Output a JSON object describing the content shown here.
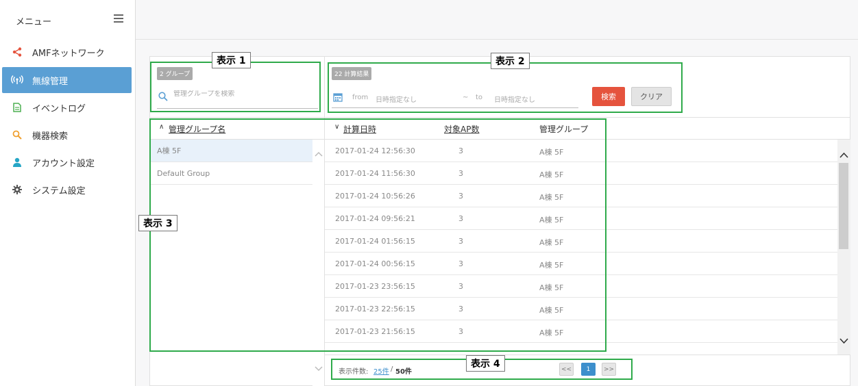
{
  "sidebar": {
    "title": "メニュー",
    "items": [
      {
        "label": "AMFネットワーク",
        "icon": "share-icon",
        "color": "#e5533d"
      },
      {
        "label": "無線管理",
        "icon": "wireless-icon",
        "color": "#ffffff",
        "active": true
      },
      {
        "label": "イベントログ",
        "icon": "document-icon",
        "color": "#4caf50"
      },
      {
        "label": "機器検索",
        "icon": "search-icon",
        "color": "#f0a030"
      },
      {
        "label": "アカウント設定",
        "icon": "user-icon",
        "color": "#26a6c6"
      },
      {
        "label": "システム設定",
        "icon": "gear-icon",
        "color": "#555555"
      }
    ]
  },
  "filters": {
    "group_count_badge": "2 グループ",
    "group_search_placeholder": "管理グループを検索",
    "result_count_badge": "22 計算結果",
    "from_label": "from",
    "from_placeholder": "日時指定なし",
    "tilde": "~",
    "to_label": "to",
    "to_placeholder": "日時指定なし",
    "search_button": "検索",
    "clear_button": "クリア"
  },
  "left_table": {
    "header": "管理グループ名",
    "rows": [
      "A棟 5F",
      "Default Group"
    ]
  },
  "right_table": {
    "headers": {
      "datetime": "計算日時",
      "ap_count": "対象AP数",
      "group": "管理グループ"
    },
    "rows": [
      {
        "datetime": "2017-01-24 12:56:30",
        "ap_count": "3",
        "group": "A棟 5F"
      },
      {
        "datetime": "2017-01-24 11:56:30",
        "ap_count": "3",
        "group": "A棟 5F"
      },
      {
        "datetime": "2017-01-24 10:56:26",
        "ap_count": "3",
        "group": "A棟 5F"
      },
      {
        "datetime": "2017-01-24 09:56:21",
        "ap_count": "3",
        "group": "A棟 5F"
      },
      {
        "datetime": "2017-01-24 01:56:15",
        "ap_count": "3",
        "group": "A棟 5F"
      },
      {
        "datetime": "2017-01-24 00:56:15",
        "ap_count": "3",
        "group": "A棟 5F"
      },
      {
        "datetime": "2017-01-23 23:56:15",
        "ap_count": "3",
        "group": "A棟 5F"
      },
      {
        "datetime": "2017-01-23 22:56:15",
        "ap_count": "3",
        "group": "A棟 5F"
      },
      {
        "datetime": "2017-01-23 21:56:15",
        "ap_count": "3",
        "group": "A棟 5F"
      }
    ]
  },
  "footer": {
    "per_page_label": "表示件数:",
    "per_page_25": "25件",
    "separator": "/",
    "per_page_50": "50件",
    "prev": "<<",
    "current_page": "1",
    "next": ">>"
  },
  "annotations": {
    "label_1": "表示 1",
    "label_2": "表示 2",
    "label_3": "表示 3",
    "label_4": "表示 4"
  },
  "colors": {
    "accent": "#5a9fd4",
    "annotation": "#2eaa4a",
    "search_button": "#e5533d",
    "page_current": "#3d8fcc"
  }
}
